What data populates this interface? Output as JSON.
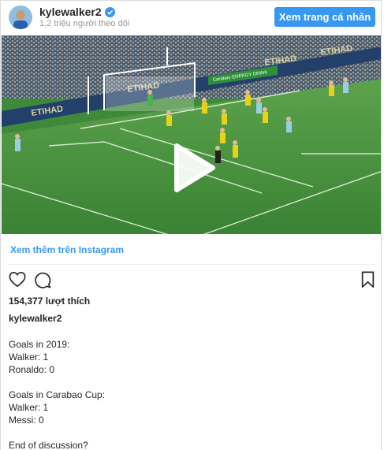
{
  "header": {
    "username": "kylewalker2",
    "followers": "1,2 triệu người theo dõi",
    "profile_button": "Xem trang cá nhân"
  },
  "colors": {
    "accent": "#3897f0",
    "text": "#262626",
    "muted": "#999999",
    "pitch": "#3f8a3a"
  },
  "media": {
    "type": "video",
    "icon": "play-icon",
    "banner_texts": [
      "ETIHAD",
      "ETIHAD",
      "ETIHAD",
      "ETIHAD",
      "Carabao ENERGY DRINK"
    ]
  },
  "more_link": "Xem thêm trên Instagram",
  "actions": {
    "like_icon": "heart-icon",
    "comment_icon": "comment-icon",
    "save_icon": "bookmark-icon"
  },
  "likes": "154,377 lượt thích",
  "author": "kylewalker2",
  "caption": {
    "lines": [
      "Goals in 2019:",
      "Walker: 1",
      "Ronaldo: 0",
      "",
      "Goals in Carabao Cup:",
      "Walker: 1",
      "Messi: 0",
      "",
      "End of discussion?"
    ]
  }
}
